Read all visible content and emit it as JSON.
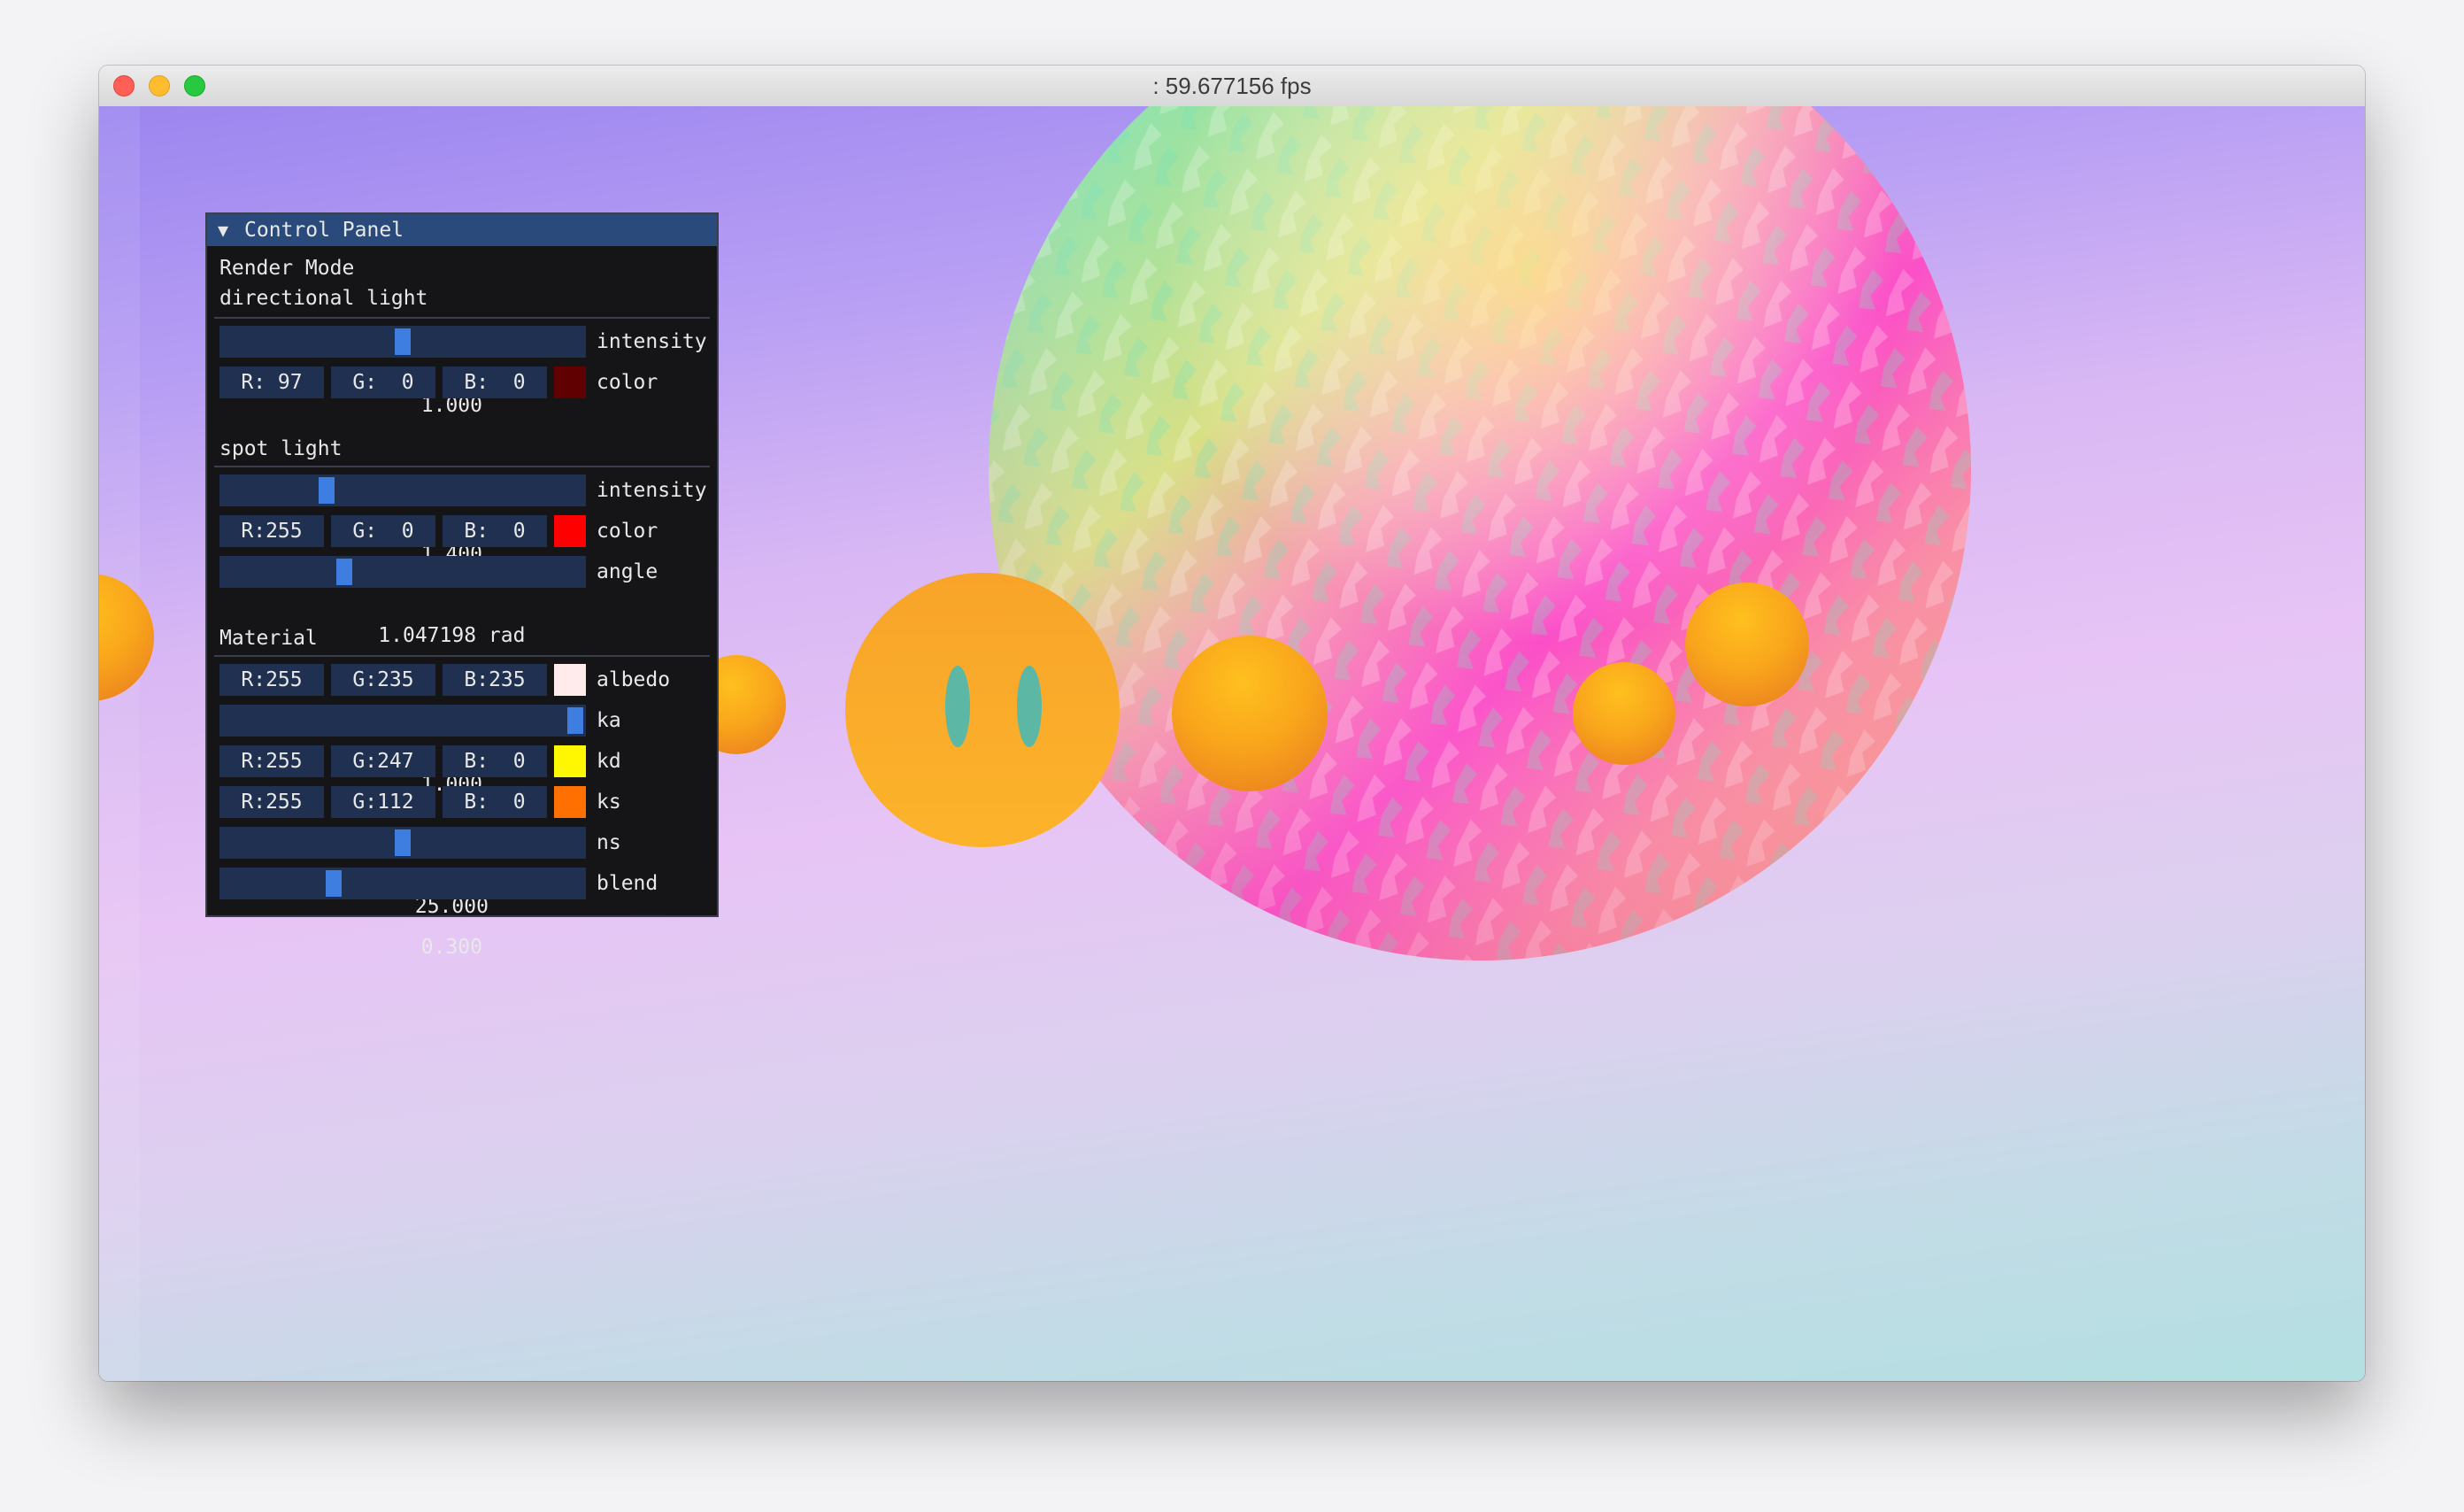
{
  "window": {
    "title": ": 59.677156 fps"
  },
  "panel": {
    "title": "Control Panel",
    "collapse_glyph": "▼",
    "render_mode_label": "Render Mode",
    "directional": {
      "header": "directional light",
      "intensity_value": "1.000",
      "intensity_label": "intensity",
      "intensity_fraction": 0.5,
      "r": "R: 97",
      "g": "G:  0",
      "b": "B:  0",
      "swatch_color": "#610000",
      "color_label": "color"
    },
    "spot": {
      "header": "spot light",
      "intensity_value": "1.400",
      "intensity_label": "intensity",
      "intensity_fraction": 0.28,
      "r": "R:255",
      "g": "G:  0",
      "b": "B:  0",
      "swatch_color": "#ff0000",
      "color_label": "color",
      "angle_value": "1.047198 rad",
      "angle_label": "angle",
      "angle_fraction": 0.33
    },
    "material": {
      "header": "Material",
      "albedo": {
        "r": "R:255",
        "g": "G:235",
        "b": "B:235",
        "swatch_color": "#ffebeb",
        "label": "albedo"
      },
      "ka": {
        "value": "1.000",
        "label": "ka",
        "fraction": 1.0
      },
      "kd": {
        "r": "R:255",
        "g": "G:247",
        "b": "B:  0",
        "swatch_color": "#fff700",
        "label": "kd"
      },
      "ks": {
        "r": "R:255",
        "g": "G:112",
        "b": "B:  0",
        "swatch_color": "#ff7000",
        "label": "ks"
      },
      "ns": {
        "value": "25.000",
        "label": "ns",
        "fraction": 0.5
      },
      "blend": {
        "value": "0.300",
        "label": "blend",
        "fraction": 0.3
      }
    }
  },
  "colors": {
    "panel_bg": "#151518",
    "panel_title_bg": "#294a7a",
    "field_bg": "#1f3050",
    "slider_grab": "#3d7ee0",
    "sphere_orange": "#f7a21f",
    "face_eye": "#5cb8a5"
  }
}
